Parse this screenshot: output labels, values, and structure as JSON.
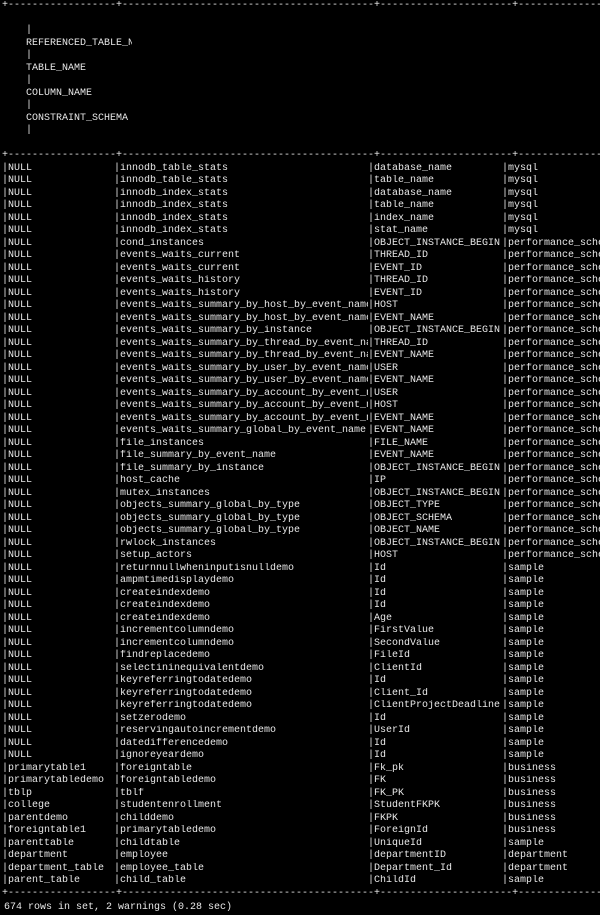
{
  "headers": [
    "REFERENCED_TABLE_NAME",
    "TABLE_NAME",
    "COLUMN_NAME",
    "CONSTRAINT_SCHEMA"
  ],
  "rows": [
    [
      "NULL",
      "innodb_table_stats",
      "database_name",
      "mysql"
    ],
    [
      "NULL",
      "innodb_table_stats",
      "table_name",
      "mysql"
    ],
    [
      "NULL",
      "innodb_index_stats",
      "database_name",
      "mysql"
    ],
    [
      "NULL",
      "innodb_index_stats",
      "table_name",
      "mysql"
    ],
    [
      "NULL",
      "innodb_index_stats",
      "index_name",
      "mysql"
    ],
    [
      "NULL",
      "innodb_index_stats",
      "stat_name",
      "mysql"
    ],
    [
      "NULL",
      "cond_instances",
      "OBJECT_INSTANCE_BEGIN",
      "performance_schema"
    ],
    [
      "NULL",
      "events_waits_current",
      "THREAD_ID",
      "performance_schema"
    ],
    [
      "NULL",
      "events_waits_current",
      "EVENT_ID",
      "performance_schema"
    ],
    [
      "NULL",
      "events_waits_history",
      "THREAD_ID",
      "performance_schema"
    ],
    [
      "NULL",
      "events_waits_history",
      "EVENT_ID",
      "performance_schema"
    ],
    [
      "NULL",
      "events_waits_summary_by_host_by_event_name",
      "HOST",
      "performance_schema"
    ],
    [
      "NULL",
      "events_waits_summary_by_host_by_event_name",
      "EVENT_NAME",
      "performance_schema"
    ],
    [
      "NULL",
      "events_waits_summary_by_instance",
      "OBJECT_INSTANCE_BEGIN",
      "performance_schema"
    ],
    [
      "NULL",
      "events_waits_summary_by_thread_by_event_name",
      "THREAD_ID",
      "performance_schema"
    ],
    [
      "NULL",
      "events_waits_summary_by_thread_by_event_name",
      "EVENT_NAME",
      "performance_schema"
    ],
    [
      "NULL",
      "events_waits_summary_by_user_by_event_name",
      "USER",
      "performance_schema"
    ],
    [
      "NULL",
      "events_waits_summary_by_user_by_event_name",
      "EVENT_NAME",
      "performance_schema"
    ],
    [
      "NULL",
      "events_waits_summary_by_account_by_event_name",
      "USER",
      "performance_schema"
    ],
    [
      "NULL",
      "events_waits_summary_by_account_by_event_name",
      "HOST",
      "performance_schema"
    ],
    [
      "NULL",
      "events_waits_summary_by_account_by_event_name",
      "EVENT_NAME",
      "performance_schema"
    ],
    [
      "NULL",
      "events_waits_summary_global_by_event_name",
      "EVENT_NAME",
      "performance_schema"
    ],
    [
      "NULL",
      "file_instances",
      "FILE_NAME",
      "performance_schema"
    ],
    [
      "NULL",
      "file_summary_by_event_name",
      "EVENT_NAME",
      "performance_schema"
    ],
    [
      "NULL",
      "file_summary_by_instance",
      "OBJECT_INSTANCE_BEGIN",
      "performance_schema"
    ],
    [
      "NULL",
      "host_cache",
      "IP",
      "performance_schema"
    ],
    [
      "NULL",
      "mutex_instances",
      "OBJECT_INSTANCE_BEGIN",
      "performance_schema"
    ],
    [
      "NULL",
      "objects_summary_global_by_type",
      "OBJECT_TYPE",
      "performance_schema"
    ],
    [
      "NULL",
      "objects_summary_global_by_type",
      "OBJECT_SCHEMA",
      "performance_schema"
    ],
    [
      "NULL",
      "objects_summary_global_by_type",
      "OBJECT_NAME",
      "performance_schema"
    ],
    [
      "NULL",
      "rwlock_instances",
      "OBJECT_INSTANCE_BEGIN",
      "performance_schema"
    ],
    [
      "NULL",
      "setup_actors",
      "HOST",
      "performance_schema"
    ],
    [
      "NULL",
      "returnnullwheninputisnulldemo",
      "Id",
      "sample"
    ],
    [
      "NULL",
      "ampmtimedisplaydemo",
      "Id",
      "sample"
    ],
    [
      "NULL",
      "createindexdemo",
      "Id",
      "sample"
    ],
    [
      "NULL",
      "createindexdemo",
      "Id",
      "sample"
    ],
    [
      "NULL",
      "createindexdemo",
      "Age",
      "sample"
    ],
    [
      "NULL",
      "incrementcolumndemo",
      "FirstValue",
      "sample"
    ],
    [
      "NULL",
      "incrementcolumndemo",
      "SecondValue",
      "sample"
    ],
    [
      "NULL",
      "findreplacedemo",
      "FileId",
      "sample"
    ],
    [
      "NULL",
      "selectininequivalentdemo",
      "ClientId",
      "sample"
    ],
    [
      "NULL",
      "keyreferringtodatedemo",
      "Id",
      "sample"
    ],
    [
      "NULL",
      "keyreferringtodatedemo",
      "Client_Id",
      "sample"
    ],
    [
      "NULL",
      "keyreferringtodatedemo",
      "ClientProjectDeadline",
      "sample"
    ],
    [
      "NULL",
      "setzerodemo",
      "Id",
      "sample"
    ],
    [
      "NULL",
      "reservingautoincrementdemo",
      "UserId",
      "sample"
    ],
    [
      "NULL",
      "datedifferencedemo",
      "Id",
      "sample"
    ],
    [
      "NULL",
      "ignoreyeardemo",
      "Id",
      "sample"
    ],
    [
      "primarytable1",
      "foreigntable",
      "Fk_pk",
      "business"
    ],
    [
      "primarytabledemo",
      "foreigntabledemo",
      "FK",
      "business"
    ],
    [
      "tblp",
      "tblf",
      "FK_PK",
      "business"
    ],
    [
      "college",
      "studentenrollment",
      "StudentFKPK",
      "business"
    ],
    [
      "parentdemo",
      "childdemo",
      "FKPK",
      "business"
    ],
    [
      "foreigntable1",
      "primarytabledemo",
      "ForeignId",
      "business"
    ],
    [
      "parenttable",
      "childtable",
      "UniqueId",
      "sample"
    ],
    [
      "department",
      "employee",
      "departmentID",
      "department"
    ],
    [
      "department_table",
      "employee_table",
      "Department_Id",
      "department"
    ],
    [
      "parent_table",
      "child_table",
      "ChildId",
      "sample"
    ]
  ],
  "status_line": "674 rows in set, 2 warnings (0.28 sec)"
}
